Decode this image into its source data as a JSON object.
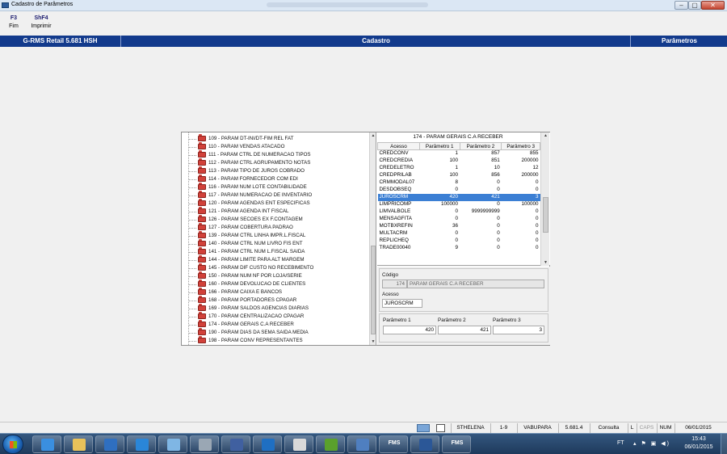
{
  "window": {
    "title": "Cadastro de Parâmetros"
  },
  "toolbar": [
    {
      "key": "F3",
      "label": "Fim"
    },
    {
      "key": "ShF4",
      "label": "Imprimir"
    }
  ],
  "header": {
    "product": "G-RMS Retail 5.681 HSH",
    "module": "Cadastro",
    "section": "Parâmetros"
  },
  "tree": {
    "items": [
      "109 - PARAM DT-INI/DT-FIM REL FAT",
      "110 - PARAM VENDAS ATACADO",
      "111 - PARAM CTRL DE NUMERACAO TIPOS",
      "112 - PARAM CTRL AGRUPAMENTO NOTAS",
      "113 - PARAM TIPO DE JUROS COBRADO",
      "114 - PARAM FORNECEDOR COM EDI",
      "116 - PARAM NUM LOTE CONTABILIDADE",
      "117 - PARAM NUMERACAO DE INVENTARIO",
      "120 - PARAM AGENDAS ENT ESPECIFICAS",
      "121 - PARAM AGENDA  INT FISCAL",
      "126 - PARAM SECOES EX F.CONTAGEM",
      "127 - PARAM COBERTURA PADRAO",
      "139 - PARAM CTRL LINHA IMPR.L.FISCAL",
      "140 - PARAM CTRL  NUM LIVRO FIS ENT",
      "141 - PARAM CTRL NUM L.FISCAL SAIDA",
      "144 - PARAM LIMITE PARA ALT MARGEM",
      "145 - PARAM DIF CUSTO NO RECEBIMENTO",
      "150 - PARAM NUM NF POR LOJA/SERIE",
      "160 - PARAM DEVOLUCAO DE CLIENTES",
      "166 - PARAM CAIXA E BANCOS",
      "168 - PARAM PORTADORES CPAGAR",
      "169 - PARAM SALDOS AGENCIAS DIARIAS",
      "170 - PARAM CENTRALIZACAO CPAGAR",
      "174 - PARAM GERAIS C.A RECEBER",
      "190 - PARAM DIAS DA SEMA SAIDA MEDIA",
      "198 - PARAM CONV REPRESENTANTES"
    ]
  },
  "grid": {
    "title": "174 - PARAM GERAIS C.A RECEBER",
    "columns": [
      "Acesso",
      "Parâmetro 1",
      "Parâmetro 2",
      "Parâmetro 3"
    ],
    "selected_index": 8,
    "rows": [
      [
        "CREDCONV",
        "1",
        "857",
        "855"
      ],
      [
        "CREDCREDIA",
        "100",
        "851",
        "200000"
      ],
      [
        "CREDELETRO",
        "1",
        "10",
        "12"
      ],
      [
        "CREDPRILAB",
        "100",
        "856",
        "200000"
      ],
      [
        "CRMMODAL07",
        "8",
        "0",
        "0"
      ],
      [
        "DESDOBSEQ",
        "0",
        "0",
        "0"
      ],
      [
        "JUROSCRM",
        "420",
        "421",
        "3"
      ],
      [
        "LIMPRICOMP",
        "100000",
        "0",
        "100000"
      ],
      [
        "LIMVALBOLE",
        "0",
        "9999999999",
        "0"
      ],
      [
        "MENSAGFITA",
        "0",
        "0",
        "0"
      ],
      [
        "MOTBXREFIN",
        "36",
        "0",
        "0"
      ],
      [
        "MULTACRM",
        "0",
        "0",
        "0"
      ],
      [
        "REPLICHEQ",
        "0",
        "0",
        "0"
      ],
      [
        "TRADE00040",
        "9",
        "0",
        "0"
      ]
    ]
  },
  "detail": {
    "codigo_label": "Código",
    "codigo_value": "174",
    "codigo_desc": "PARAM GERAIS C.A RECEBER",
    "acesso_label": "Acesso",
    "acesso_value": "JUROSCRM",
    "param1_label": "Parâmetro 1",
    "param1_value": "420",
    "param2_label": "Parâmetro 2",
    "param2_value": "421",
    "param3_label": "Parâmetro 3",
    "param3_value": "3"
  },
  "statusbar": {
    "user": "STHELENA",
    "code": "1-9",
    "server": "VABUPARA",
    "version": "5.681.4",
    "mode": "Consulta",
    "key_l": "L",
    "key_caps": "CAPS",
    "key_num": "NUM",
    "date": "06/01/2015"
  },
  "taskbar": {
    "apps": [
      {
        "name": "internet-explorer-icon",
        "color": "#3a8fe0"
      },
      {
        "name": "file-explorer-icon",
        "color": "#e9c25a"
      },
      {
        "name": "media-player-icon",
        "color": "#2f6fc0"
      },
      {
        "name": "lync-icon",
        "color": "#2a86d8"
      },
      {
        "name": "photos-icon",
        "color": "#7fb6e4"
      },
      {
        "name": "calculator-icon",
        "color": "#9aa7b4"
      },
      {
        "name": "network-icon",
        "color": "#4060a0"
      },
      {
        "name": "outlook-icon",
        "color": "#1f6fc2"
      },
      {
        "name": "tools-icon",
        "color": "#d9d9d9"
      },
      {
        "name": "fms-app-icon",
        "color": "#5aa02c"
      },
      {
        "name": "settings-icon",
        "color": "#4f7fc0"
      },
      {
        "name": "fms-launcher-1",
        "label": "FMS"
      },
      {
        "name": "word-icon",
        "color": "#2b5797"
      },
      {
        "name": "fms-launcher-2",
        "label": "FMS"
      }
    ],
    "lang": "FT",
    "time": "15:43",
    "date": "06/01/2015"
  }
}
